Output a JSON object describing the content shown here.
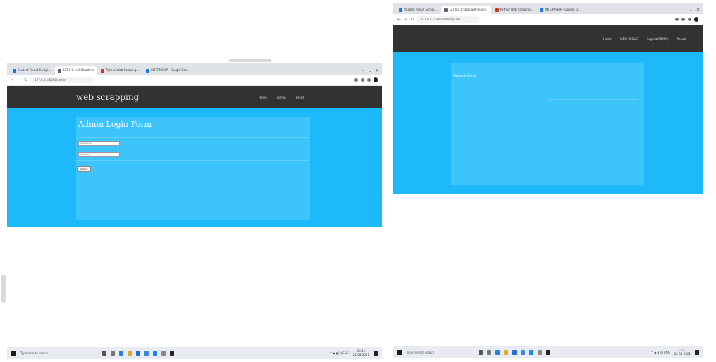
{
  "left": {
    "tabs": [
      {
        "label": "Student Result Scrapi...",
        "favicon_color": "#1a73e8",
        "active": false
      },
      {
        "label": "127.0.0.1:5000/admin",
        "favicon_color": "#5f6368",
        "active": true
      },
      {
        "label": "Python Web Scraping...",
        "favicon_color": "#d93025",
        "active": false
      },
      {
        "label": "INTERNSHIP - Google Doc...",
        "favicon_color": "#1a73e8",
        "active": false
      }
    ],
    "url": "127.0.0.1:5000/admin",
    "site": {
      "brand": "web scrapping",
      "nav": [
        "Home",
        "Admin",
        "Result"
      ],
      "form_title": "Admin Login Form",
      "username_placeholder": "Username",
      "password_placeholder": "Password",
      "submit_label": "Submit"
    },
    "taskbar": {
      "search_text": "Type here to search",
      "time": "13:41",
      "date": "22-08-2021"
    }
  },
  "right": {
    "tabs": [
      {
        "label": "Student Result Scrapi...",
        "favicon_color": "#1a73e8",
        "active": false
      },
      {
        "label": "127.0.0.1:5000/adminpan...",
        "favicon_color": "#5f6368",
        "active": true
      },
      {
        "label": "Python Web Scraping...",
        "favicon_color": "#d93025",
        "active": false
      },
      {
        "label": "INTERNSHIP - Google D...",
        "favicon_color": "#1a73e8",
        "active": false
      }
    ],
    "url": "127.0.0.1:5000/adminpanel",
    "site": {
      "nav": [
        "Home",
        "VIEW RESULT",
        "Logout(ADMIN)",
        "Result"
      ],
      "panel_heading": "Welcome Admin"
    },
    "taskbar": {
      "search_text": "Type here to search",
      "time": "13:42",
      "date": "22-08-2021"
    }
  },
  "colors": {
    "site_header": "#323232",
    "site_body": "#1eb9fa",
    "panel": "#3cc4fb"
  }
}
